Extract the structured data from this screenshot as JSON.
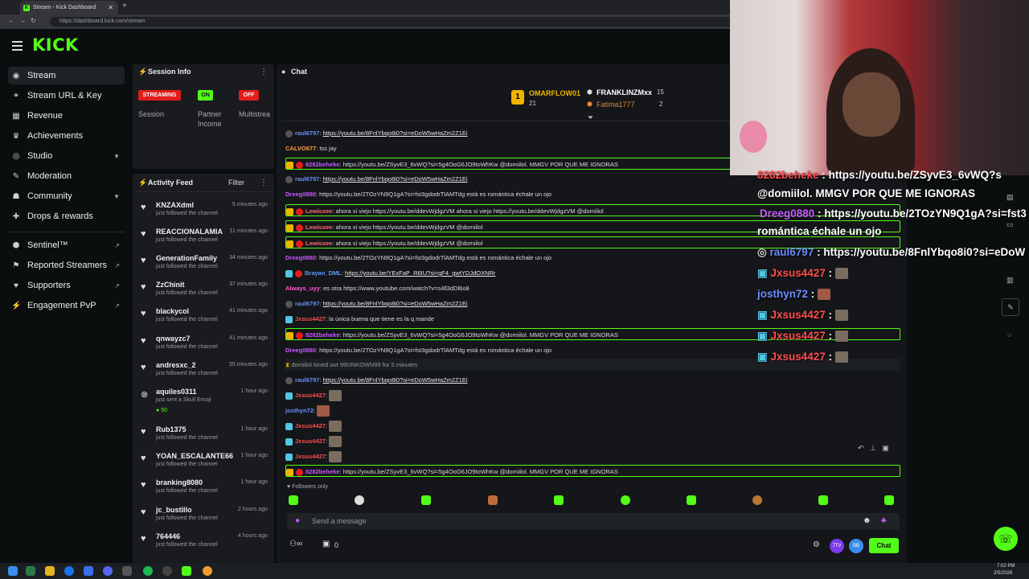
{
  "browser": {
    "tab_title": "Stream - Kick Dashboard",
    "url": "https://dashboard.kick.com/stream"
  },
  "header": {
    "logo": "KICK"
  },
  "sidebar": {
    "items": [
      {
        "label": "Stream",
        "icon": "broadcast-icon"
      },
      {
        "label": "Stream URL & Key",
        "icon": "link-icon"
      },
      {
        "label": "Revenue",
        "icon": "revenue-icon"
      },
      {
        "label": "Achievements",
        "icon": "trophy-icon"
      },
      {
        "label": "Studio",
        "icon": "studio-icon"
      },
      {
        "label": "Moderation",
        "icon": "wrench-icon"
      },
      {
        "label": "Community",
        "icon": "community-icon"
      },
      {
        "label": "Drops & rewards",
        "icon": "gift-icon"
      },
      {
        "label": "Sentinel™",
        "icon": "shield-icon"
      },
      {
        "label": "Reported Streamers",
        "icon": "flag-icon"
      },
      {
        "label": "Supporters",
        "icon": "heart-icon"
      },
      {
        "label": "Engagement PvP",
        "icon": "bolt-icon"
      }
    ]
  },
  "session": {
    "title": "Session Info",
    "streaming_label": "STREAMING",
    "on_label": "ON",
    "off_label": "OFF",
    "session_label": "Session",
    "partner_label_1": "Partner",
    "partner_label_2": "Income",
    "multistream_label": "Multistrea"
  },
  "activity": {
    "title": "Activity Feed",
    "filter_label": "Filter",
    "items": [
      {
        "name": "KNZAXdml",
        "sub": "just followed the channel",
        "time": "5 minutes ago"
      },
      {
        "name": "REACCIONALAMIA",
        "sub": "just followed the channel",
        "time": "11 minutes ago"
      },
      {
        "name": "GenerationFamily",
        "sub": "just followed the channel",
        "time": "34 minutes ago"
      },
      {
        "name": "ZzChinit",
        "sub": "just followed the channel",
        "time": "37 minutes ago"
      },
      {
        "name": "blackycol",
        "sub": "just followed the channel",
        "time": "41 minutes ago"
      },
      {
        "name": "qnwayzc7",
        "sub": "just followed the channel",
        "time": "41 minutes ago"
      },
      {
        "name": "andresxc_2",
        "sub": "just followed the channel",
        "time": "55 minutes ago"
      },
      {
        "name": "aquiles0311",
        "sub": "just sent a Skull Emoji",
        "time": "1 hour ago",
        "extra": "50"
      },
      {
        "name": "Rub1375",
        "sub": "just followed the channel",
        "time": "1 hour ago"
      },
      {
        "name": "YOAN_ESCALANTE66",
        "sub": "just followed the channel",
        "time": "1 hour ago"
      },
      {
        "name": "branking8080",
        "sub": "just followed the channel",
        "time": "1 hour ago"
      },
      {
        "name": "jc_bustillo",
        "sub": "just followed the channel",
        "time": "2 hours ago"
      },
      {
        "name": "764446",
        "sub": "just followed the channel",
        "time": "4 hours ago"
      }
    ]
  },
  "chat": {
    "title": "Chat",
    "leaderboard": {
      "first_name": "OMARFLOW01",
      "first_count": "21",
      "second_name": "FRANKLINZMxx",
      "second_count": "15",
      "third_name": "Fatima1777",
      "third_count": "2"
    },
    "messages": [
      {
        "user": "raul6797",
        "color": "#6b8cff",
        "text": "https://youtu.be/8FnlYbqo8i0?si=eDoW5wHaZm2Z1Ei",
        "hl": false
      },
      {
        "user": "CALVO677",
        "color": "#ff9f43",
        "text": "tss jay",
        "hl": false
      },
      {
        "user": "8282beheke",
        "color": "#c65bff",
        "text": "https://youtu.be/ZSyvE3_6vWQ?si=5g4OoG6JO9toWhKw @domiilol. MMGV POR QUE ME IGNORAS",
        "hl": true
      },
      {
        "user": "raul6797",
        "color": "#6b8cff",
        "text": "https://youtu.be/8FnlYbqo8i0?si=eDoW5wHaZm2Z1Ei",
        "hl": false
      },
      {
        "user": "Dreeg0880",
        "color": "#c65bff",
        "text": "https://youtu.be/2TOzYN9Q1gA?si=fst3gdodrTlAMTdg está es romántica échale un ojo",
        "hl": false
      },
      {
        "user": "Lewisxee",
        "color": "#ff6b6b",
        "text": "ahora si viejo https://youtu.be/ddevWjdgzVM ahora si viejo https://youtu.be/ddevWjdgzVM @domiilol",
        "hl": true
      },
      {
        "user": "Lewisxee",
        "color": "#ff6b6b",
        "text": "ahora si viejo https://youtu.be/ddevWjdgzVM @domiilol",
        "hl": true
      },
      {
        "user": "Lewisxee",
        "color": "#ff6b6b",
        "text": "ahora si viejo https://youtu.be/ddevWjdgzVM @domiilol",
        "hl": true
      },
      {
        "user": "Dreeg0880",
        "color": "#c65bff",
        "text": "https://youtu.be/2TOzYN9Q1gA?si=fst3gdodrTlAMTdg está es romántica échale un ojo",
        "hl": false
      },
      {
        "user": "Brayan_DML",
        "color": "#5b9cff",
        "text": "https://youtu.be/YExFaP_R6IU?si=gF4_gwtYDJdOXNRr",
        "hl": false
      },
      {
        "user": "Always_uyy",
        "color": "#ff5bd1",
        "text": "es otra https://www.youtube.com/watch?v=s4ll3dDl6o8",
        "hl": false
      },
      {
        "user": "raul6797",
        "color": "#6b8cff",
        "text": "https://youtu.be/8FnlYbqo8i0?si=eDoW5wHaZm2Z1Ei",
        "hl": false
      },
      {
        "user": "Jxsus4427",
        "color": "#ff4d4d",
        "text": "la única buena que tiene es la q mande",
        "hl": false
      },
      {
        "user": "8282beheke",
        "color": "#c65bff",
        "text": "https://youtu.be/ZSyvE3_6vWQ?si=5g4OoG6JO9toWhKw @domiilol. MMGV POR QUE ME IGNORAS",
        "hl": true
      },
      {
        "user": "Dreeg0880",
        "color": "#c65bff",
        "text": "https://youtu.be/2TOzYN9Q1gA?si=fst3gdodrTlAMTdg está es romántica échale un ojo",
        "hl": false
      },
      {
        "user": "domiilol",
        "color": "#aaaaaa",
        "text": "timed out 99UNKOWN99 for 5 minutes",
        "hl": false,
        "system": true
      },
      {
        "user": "raul6797",
        "color": "#6b8cff",
        "text": "https://youtu.be/8FnlYbqo8i0?si=eDoW5wHaZm2Z1Ei",
        "hl": false
      },
      {
        "user": "Jxsus4427",
        "color": "#ff4d4d",
        "text": "",
        "hl": false,
        "emote": true
      },
      {
        "user": "josthyn72",
        "color": "#6b8cff",
        "text": "",
        "hl": false,
        "emote": true
      },
      {
        "user": "Jxsus4427",
        "color": "#ff4d4d",
        "text": "",
        "hl": false,
        "emote": true
      },
      {
        "user": "Jxsus4427",
        "color": "#ff4d4d",
        "text": "",
        "hl": false,
        "emote": true
      },
      {
        "user": "Jxsus4427",
        "color": "#ff4d4d",
        "text": "",
        "hl": false,
        "emote": true
      },
      {
        "user": "8282beheke",
        "color": "#c65bff",
        "text": "https://youtu.be/ZSyvE3_6vWQ?si=5g4OoG6JO9toWhKw @domiilol. MMGV POR QUE ME IGNORAS",
        "hl": true
      }
    ],
    "followers_only": "Followers only",
    "input_placeholder": "Send a message",
    "count": "0",
    "send_label": "Chat",
    "avatar_1": "7TV",
    "avatar_2": "BB"
  },
  "overlay": {
    "lines": [
      {
        "user": "8282beheke",
        "text": "https://youtu.be/ZSyvE3_6vWQ?s"
      },
      {
        "user": "",
        "text": "@domiilol. MMGV POR QUE ME IGNORAS"
      },
      {
        "user": "Dreeg0880",
        "text": "https://youtu.be/2TOzYN9Q1gA?si=fst3"
      },
      {
        "user": "",
        "text": "romántica échale un ojo"
      },
      {
        "user": "raul6797",
        "text": "https://youtu.be/8FnlYbqo8i0?si=eDoW"
      },
      {
        "user": "Jxsus4427",
        "text": ""
      },
      {
        "user": "josthyn72",
        "text": ""
      },
      {
        "user": "Jxsus4427",
        "text": ""
      },
      {
        "user": "Jxsus4427",
        "text": ""
      },
      {
        "user": "Jxsus4427",
        "text": ""
      }
    ]
  },
  "taskbar": {
    "time": "7:02 PM",
    "date": "2/5/2026"
  },
  "colors": {
    "accent": "#53fc18",
    "danger": "#e31c1c",
    "panel": "#191b1f"
  }
}
